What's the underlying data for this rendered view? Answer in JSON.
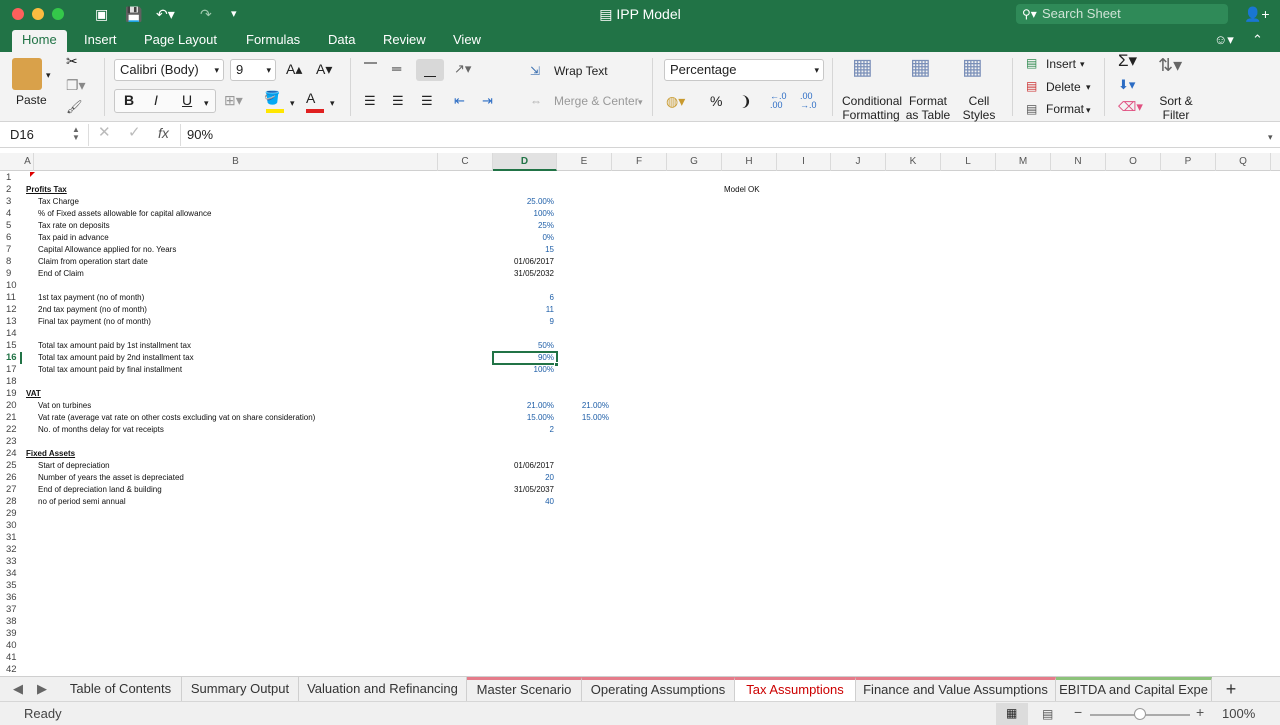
{
  "window": {
    "title": "IPP Model",
    "search_placeholder": "Search Sheet"
  },
  "menu": {
    "tabs": [
      "Home",
      "Insert",
      "Page Layout",
      "Formulas",
      "Data",
      "Review",
      "View"
    ],
    "active": "Home"
  },
  "ribbon": {
    "paste": "Paste",
    "font_name": "Calibri (Body)",
    "font_size": "9",
    "wrap_text": "Wrap Text",
    "merge_center": "Merge & Center",
    "number_format": "Percentage",
    "conditional_formatting": [
      "Conditional",
      "Formatting"
    ],
    "format_as_table": [
      "Format",
      "as Table"
    ],
    "cell_styles": [
      "Cell",
      "Styles"
    ],
    "insert": "Insert",
    "delete": "Delete",
    "format": "Format",
    "sort_filter": [
      "Sort &",
      "Filter"
    ],
    "colors": {
      "font_red": "#e02020",
      "highlight_yellow": "#ffe600"
    }
  },
  "formula_bar": {
    "name_box": "D16",
    "fx": "fx",
    "value": "90%"
  },
  "columns": [
    "A",
    "B",
    "C",
    "D",
    "E",
    "F",
    "G",
    "H",
    "I",
    "J",
    "K",
    "L",
    "M",
    "N",
    "O",
    "P",
    "Q"
  ],
  "rows": [
    "1",
    "2",
    "3",
    "4",
    "5",
    "6",
    "7",
    "8",
    "9",
    "10",
    "11",
    "12",
    "13",
    "14",
    "15",
    "16",
    "17",
    "18",
    "19",
    "20",
    "21",
    "22",
    "23",
    "24",
    "25",
    "26",
    "27",
    "28",
    "29",
    "30",
    "31",
    "32",
    "33",
    "34",
    "35",
    "36",
    "37",
    "38",
    "39",
    "40",
    "41",
    "42"
  ],
  "cells": {
    "r2": {
      "a": "Profits Tax",
      "h": "Model OK"
    },
    "r3": {
      "b": "Tax Charge",
      "d": "25.00%"
    },
    "r4": {
      "b": "% of Fixed assets allowable for capital allowance",
      "d": "100%"
    },
    "r5": {
      "b": "Tax rate on deposits",
      "d": "25%"
    },
    "r6": {
      "b": "Tax paid in advance",
      "d": "0%"
    },
    "r7": {
      "b": "Capital Allowance applied for no. Years",
      "d": "15"
    },
    "r8": {
      "b": "Claim from operation start date",
      "d": "01/06/2017"
    },
    "r9": {
      "b": "End of Claim",
      "d": "31/05/2032"
    },
    "r11": {
      "b": "1st tax payment (no of month)",
      "d": "6"
    },
    "r12": {
      "b": "2nd tax payment (no of month)",
      "d": "11"
    },
    "r13": {
      "b": "Final tax payment (no of month)",
      "d": "9"
    },
    "r15": {
      "b": "Total tax amount paid by 1st installment tax",
      "d": "50%"
    },
    "r16": {
      "b": "Total tax amount paid by 2nd installment tax",
      "d": "90%"
    },
    "r17": {
      "b": "Total tax amount paid by final installment",
      "d": "100%"
    },
    "r19": {
      "a": "VAT"
    },
    "r20": {
      "b": "Vat on turbines",
      "d": "21.00%",
      "e": "21.00%"
    },
    "r21": {
      "b": "Vat rate (average vat rate on other costs excluding vat on share consideration)",
      "d": "15.00%",
      "e": "15.00%"
    },
    "r22": {
      "b": "No. of months delay for vat receipts",
      "d": "2"
    },
    "r24": {
      "a": "Fixed Assets"
    },
    "r25": {
      "b": "Start of depreciation",
      "d": "01/06/2017"
    },
    "r26": {
      "b": "Number of years the asset is depreciated",
      "d": "20"
    },
    "r27": {
      "b": "End of depreciation land & building",
      "d": "31/05/2037"
    },
    "r28": {
      "b": "no of period semi annual",
      "d": "40"
    }
  },
  "sheet_tabs": [
    "Table of Contents",
    "Summary Output",
    "Valuation and Refinancing",
    "Master Scenario",
    "Operating Assumptions",
    "Tax Assumptions",
    "Finance and Value Assumptions",
    "EBITDA and Capital Expe"
  ],
  "active_sheet": "Tax Assumptions",
  "status": {
    "ready": "Ready",
    "zoom": "100%"
  }
}
